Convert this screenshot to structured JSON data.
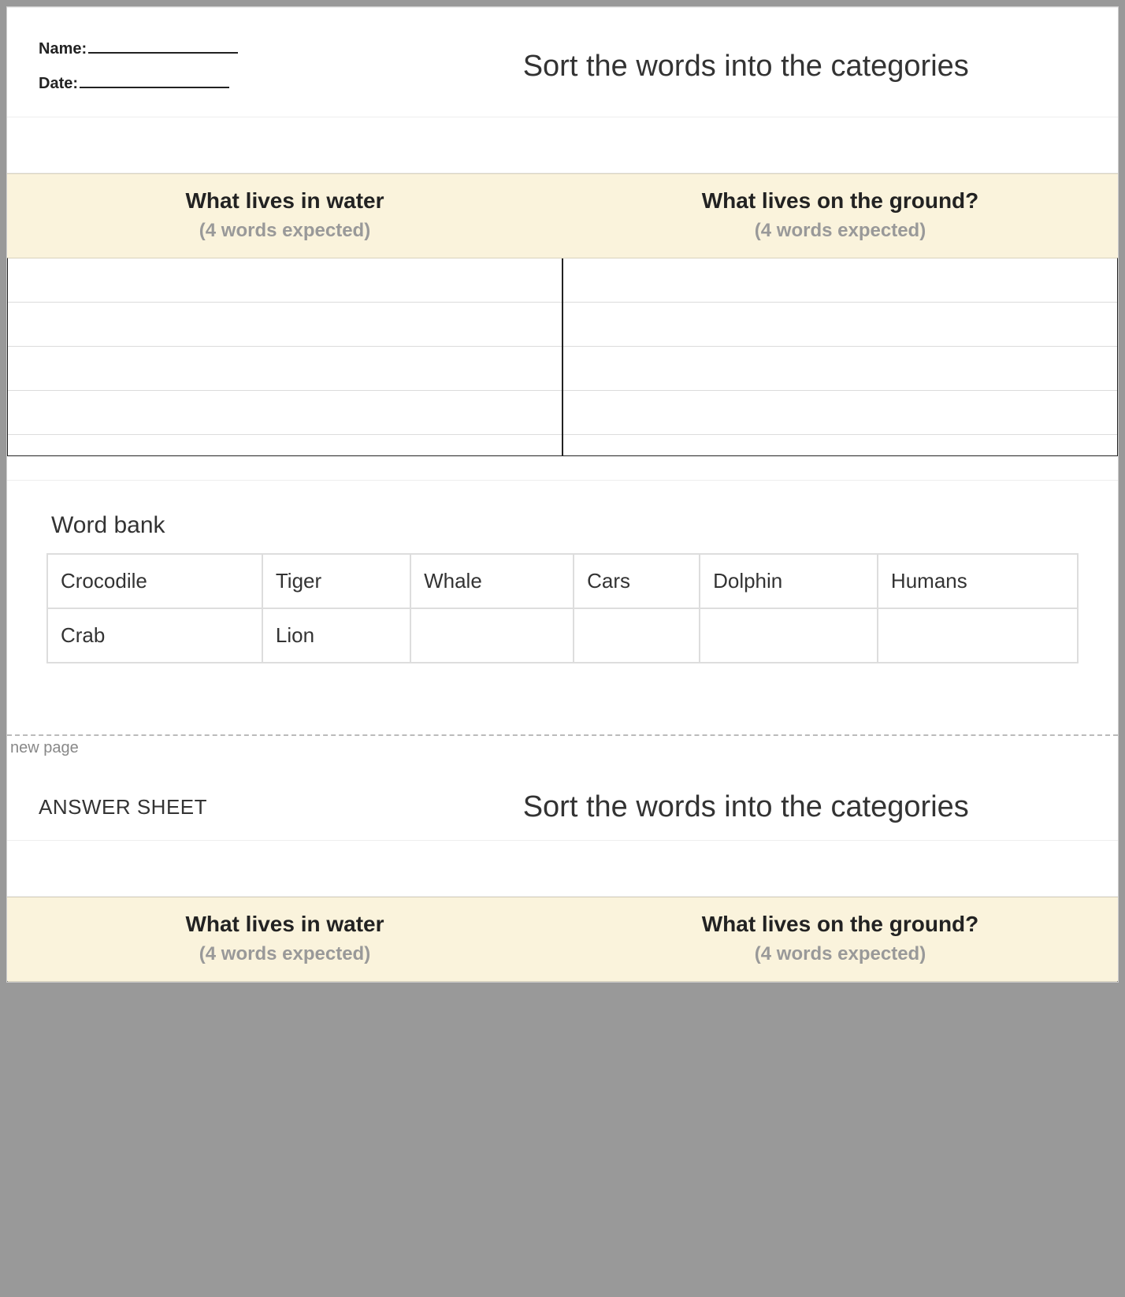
{
  "worksheet": {
    "name_label": "Name:",
    "date_label": "Date:",
    "title": "Sort the words into the categories",
    "categories": [
      {
        "title": "What lives in water",
        "subtitle": "(4 words expected)"
      },
      {
        "title": "What lives on the ground?",
        "subtitle": "(4 words expected)"
      }
    ],
    "wordbank_title": "Word bank",
    "wordbank": [
      "Crocodile",
      "Tiger",
      "Whale",
      "Cars",
      "Dolphin",
      "Humans",
      "Crab",
      "Lion",
      "",
      "",
      "",
      ""
    ]
  },
  "page_break_label": "new page",
  "answer_sheet": {
    "label": "ANSWER SHEET",
    "title": "Sort the words into the categories",
    "categories": [
      {
        "title": "What lives in water",
        "subtitle": "(4 words expected)"
      },
      {
        "title": "What lives on the ground?",
        "subtitle": "(4 words expected)"
      }
    ]
  }
}
